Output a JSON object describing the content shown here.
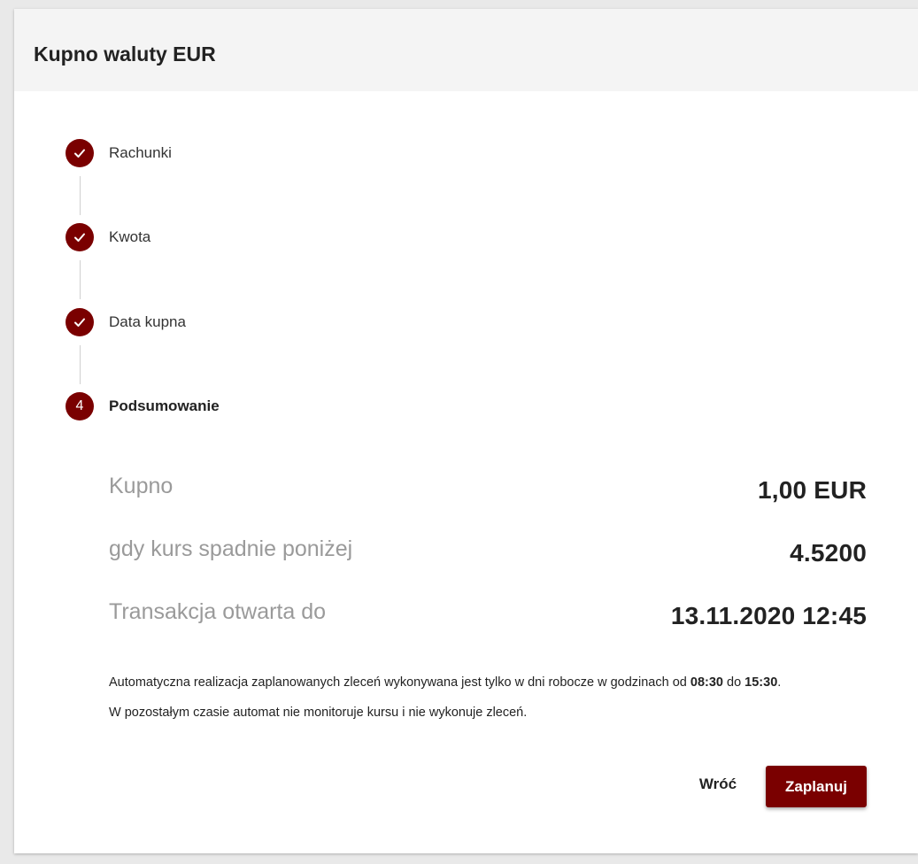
{
  "header": {
    "title": "Kupno waluty EUR"
  },
  "stepper": {
    "steps": [
      {
        "label": "Rachunki",
        "state": "completed",
        "icon": "check-icon"
      },
      {
        "label": "Kwota",
        "state": "completed",
        "icon": "check-icon"
      },
      {
        "label": "Data kupna",
        "state": "completed",
        "icon": "check-icon"
      },
      {
        "label": "Podsumowanie",
        "state": "active",
        "number": "4"
      }
    ]
  },
  "summary": {
    "rows": [
      {
        "label": "Kupno",
        "value": "1,00 EUR"
      },
      {
        "label": "gdy kurs spadnie poniżej",
        "value": "4.5200"
      },
      {
        "label": "Transakcja otwarta do",
        "value": "13.11.2020 12:45"
      }
    ]
  },
  "notice": {
    "line1_prefix": "Automatyczna realizacja zaplanowanych zleceń wykonywana jest tylko w dni robocze w godzinach od ",
    "line1_time_from": "08:30",
    "line1_mid": " do ",
    "line1_time_to": "15:30",
    "line1_suffix": ".",
    "line2": "W pozostałym czasie automat nie monitoruje kursu i nie wykonuje zleceń."
  },
  "actions": {
    "back_label": "Wróć",
    "submit_label": "Zaplanuj"
  },
  "colors": {
    "accent": "#7a0000",
    "header_bg": "#f4f4f4",
    "label_gray": "#9a9a9a"
  }
}
